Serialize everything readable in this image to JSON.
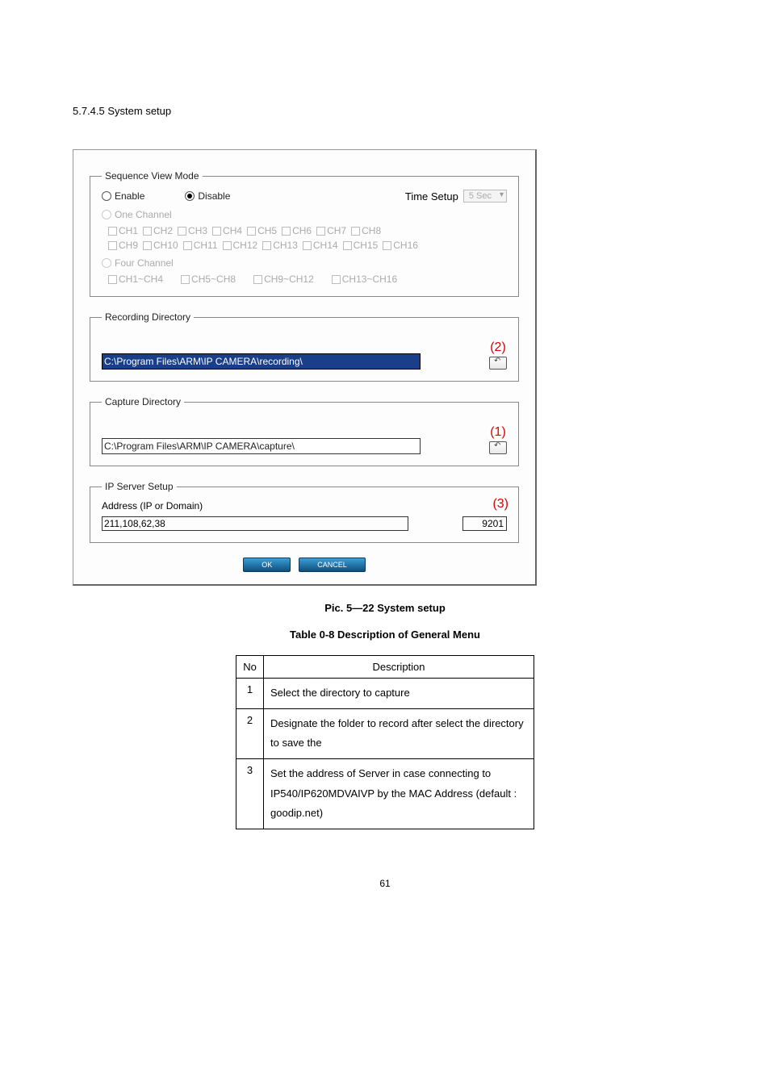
{
  "heading": "5.7.4.5 System setup",
  "dialog": {
    "sequence": {
      "legend": "Sequence View Mode",
      "enable_label": "Enable",
      "disable_label": "Disable",
      "time_setup_label": "Time Setup",
      "time_setup_value": "5 Sec",
      "one_channel_label": "One Channel",
      "channels_row1": [
        "CH1",
        "CH2",
        "CH3",
        "CH4",
        "CH5",
        "CH6",
        "CH7",
        "CH8"
      ],
      "channels_row2": [
        "CH9",
        "CH10",
        "CH11",
        "CH12",
        "CH13",
        "CH14",
        "CH15",
        "CH16"
      ],
      "four_channel_label": "Four Channel",
      "four_channels": [
        "CH1~CH4",
        "CH5~CH8",
        "CH9~CH12",
        "CH13~CH16"
      ]
    },
    "recording": {
      "legend": "Recording Directory",
      "path": "C:\\Program Files\\ARM\\IP CAMERA\\recording\\",
      "annot": "(2)"
    },
    "capture": {
      "legend": "Capture Directory",
      "path": "C:\\Program Files\\ARM\\IP CAMERA\\capture\\",
      "annot": "(1)"
    },
    "ipserver": {
      "legend": "IP Server Setup",
      "addr_label": "Address (IP or Domain)",
      "addr_value": "211,108,62,38",
      "port_value": "9201",
      "annot": "(3)"
    },
    "ok_label": "OK",
    "cancel_label": "CANCEL"
  },
  "fig_caption": "Pic. 5―22 System setup",
  "table_caption": "Table   0-8 Description of General Menu",
  "table": {
    "headers": [
      "No",
      "Description"
    ],
    "rows": [
      {
        "no": "1",
        "desc": "Select the directory to capture"
      },
      {
        "no": "2",
        "desc": "Designate the folder to record after select the directory to save the"
      },
      {
        "no": "3",
        "desc": "Set the address of Server in case connecting to IP540/IP620MDVAIVP by the MAC Address (default : goodip.net)"
      }
    ]
  },
  "page_number": "61"
}
